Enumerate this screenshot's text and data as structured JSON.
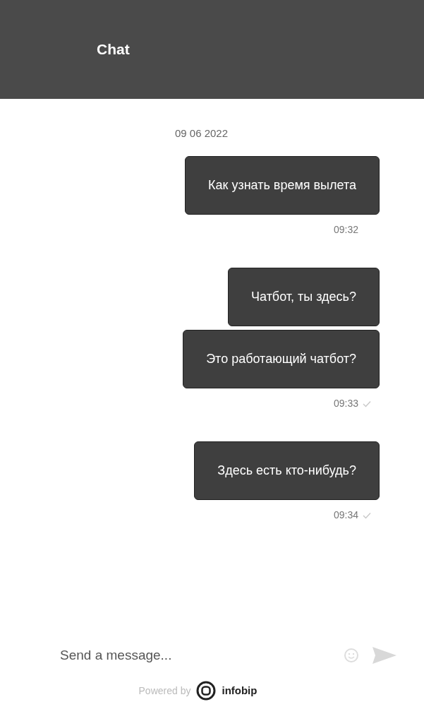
{
  "header": {
    "title": "Chat"
  },
  "date": "09 06 2022",
  "groups": [
    {
      "messages": [
        "Как узнать время вылета"
      ],
      "time": "09:32",
      "delivered": false
    },
    {
      "messages": [
        "Чатбот, ты здесь?",
        "Это работающий чатбот?"
      ],
      "time": "09:33",
      "delivered": true
    },
    {
      "messages": [
        "Здесь есть кто-нибудь?"
      ],
      "time": "09:34",
      "delivered": true
    }
  ],
  "composer": {
    "placeholder": "Send a message..."
  },
  "footer": {
    "powered_by": "Powered by",
    "brand": "infobip"
  }
}
